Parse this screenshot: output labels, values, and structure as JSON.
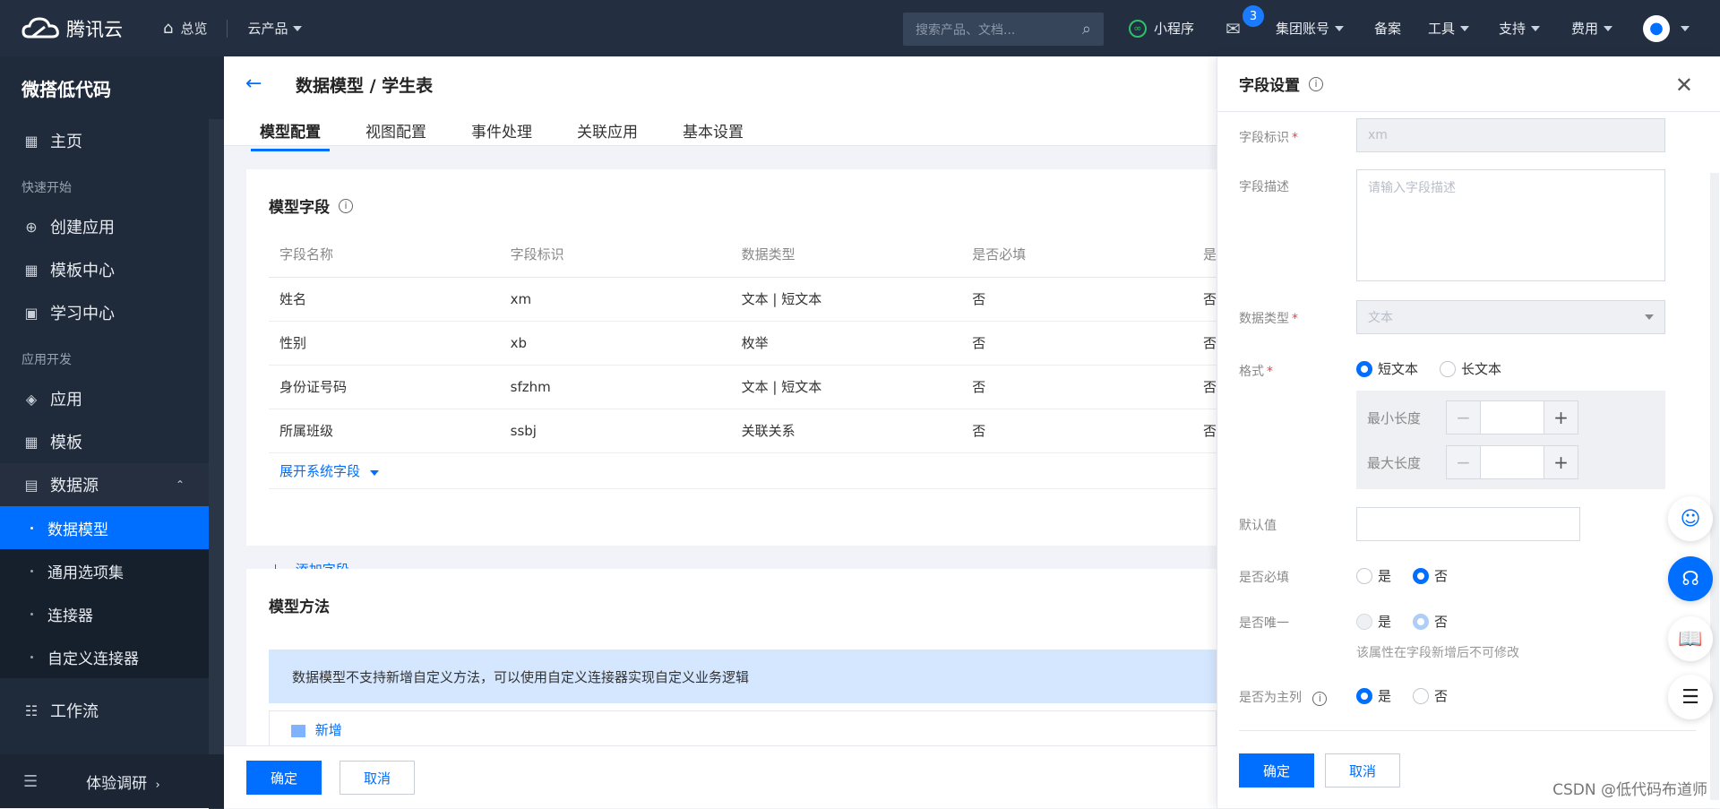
{
  "topbar": {
    "brand": "腾讯云",
    "overview": "总览",
    "products": "云产品",
    "search_placeholder": "搜索产品、文档...",
    "miniprogram": "小程序",
    "mail_badge": "3",
    "group_account": "集团账号",
    "filing": "备案",
    "tools": "工具",
    "support": "支持",
    "billing": "费用"
  },
  "sidebar": {
    "title": "微搭低代码",
    "home": "主页",
    "group_quickstart": "快速开始",
    "create_app": "创建应用",
    "template_center": "模板中心",
    "learning_center": "学习中心",
    "group_appdev": "应用开发",
    "apps": "应用",
    "templates": "模板",
    "datasource": "数据源",
    "sub_items": [
      "数据模型",
      "通用选项集",
      "连接器",
      "自定义连接器"
    ],
    "workflow": "工作流",
    "bottom_label": "体验调研"
  },
  "main": {
    "title": "数据模型 / 学生表",
    "tabs": [
      "模型配置",
      "视图配置",
      "事件处理",
      "关联应用",
      "基本设置"
    ],
    "fields_card": {
      "title": "模型字段",
      "columns": [
        "字段名称",
        "字段标识",
        "数据类型",
        "是否必填",
        "是"
      ],
      "rows": [
        [
          "姓名",
          "xm",
          "文本 | 短文本",
          "否",
          "否"
        ],
        [
          "性别",
          "xb",
          "枚举",
          "否",
          "否"
        ],
        [
          "身份证号码",
          "sfzhm",
          "文本 | 短文本",
          "否",
          "否"
        ],
        [
          "所属班级",
          "ssbj",
          "关联关系",
          "否",
          "否"
        ]
      ],
      "expand_system": "展开系统字段",
      "add_field": "添加字段"
    },
    "methods_card": {
      "title": "模型方法",
      "notice": "数据模型不支持新增自定义方法，可以使用自定义连接器实现自定义业务逻辑",
      "add_label": "新增"
    },
    "confirm": "确定",
    "cancel": "取消"
  },
  "panel": {
    "title": "字段设置",
    "field_id_label": "字段标识",
    "field_id_value": "xm",
    "desc_label": "字段描述",
    "desc_placeholder": "请输入字段描述",
    "type_label": "数据类型",
    "type_value": "文本",
    "format_label": "格式",
    "format_short": "短文本",
    "format_long": "长文本",
    "min_len_label": "最小长度",
    "max_len_label": "最大长度",
    "default_label": "默认值",
    "required_label": "是否必填",
    "unique_label": "是否唯一",
    "primary_label": "是否为主列",
    "yes": "是",
    "no": "否",
    "unique_hint": "该属性在字段新增后不可修改",
    "confirm": "确定",
    "cancel": "取消"
  },
  "watermark": "CSDN @低代码布道师",
  "colors": {
    "accent": "#006eff",
    "topbar": "#232f40",
    "sidebar": "#1f2a3a"
  }
}
